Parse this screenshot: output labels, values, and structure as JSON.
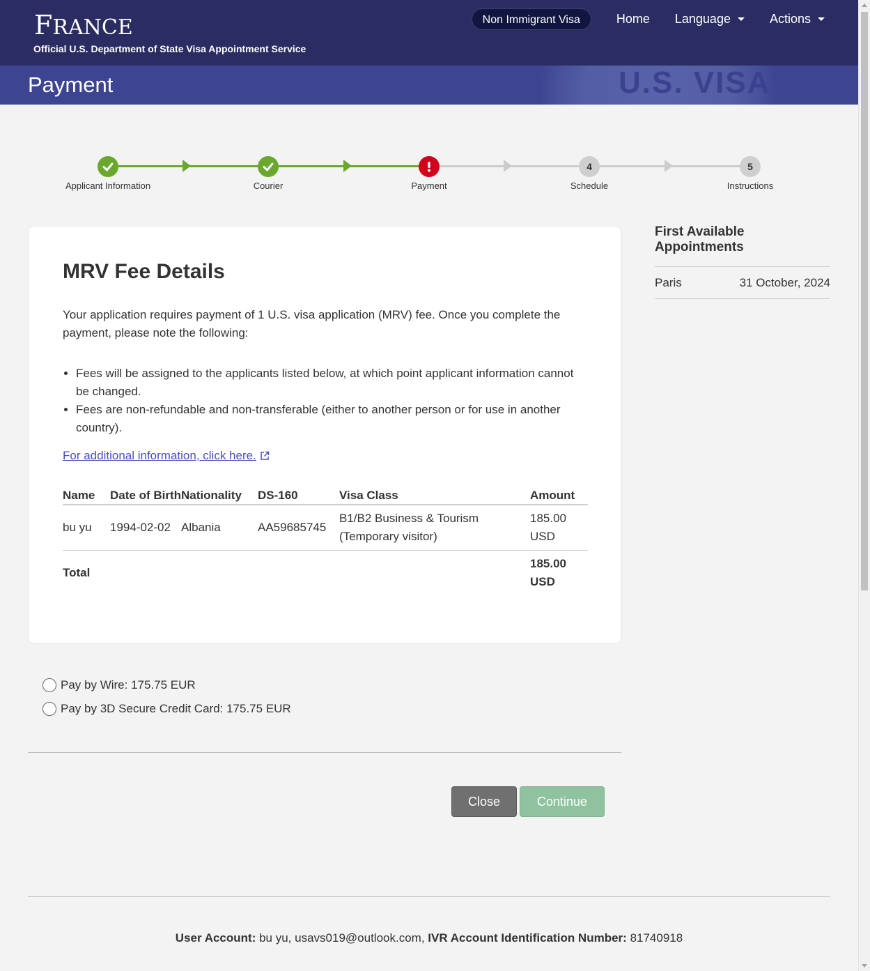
{
  "header": {
    "country_first": "F",
    "country_rest": "RANCE",
    "subtitle": "Official U.S. Department of State Visa Appointment Service",
    "nav": {
      "visa_type": "Non Immigrant Visa",
      "home": "Home",
      "language": "Language",
      "actions": "Actions"
    },
    "page_title": "Payment",
    "seal_text": "U.S. VISA"
  },
  "stepper": {
    "steps": [
      {
        "label": "Applicant Information",
        "state": "done",
        "icon": "check-icon"
      },
      {
        "label": "Courier",
        "state": "done",
        "icon": "check-icon"
      },
      {
        "label": "Payment",
        "state": "current",
        "icon": "exclamation-icon"
      },
      {
        "label": "Schedule",
        "state": "todo",
        "number": "4"
      },
      {
        "label": "Instructions",
        "state": "todo",
        "number": "5"
      }
    ]
  },
  "fee_details": {
    "title": "MRV Fee Details",
    "intro": "Your application requires payment of 1 U.S. visa application (MRV) fee. Once you complete the payment, please note the following:",
    "bullets": [
      "Fees will be assigned to the applicants listed below, at which point applicant information cannot be changed.",
      "Fees are non-refundable and non-transferable (either to another person or for use in another country)."
    ],
    "more_link": "For additional information, click here.",
    "table": {
      "headers": {
        "name": "Name",
        "dob": "Date of Birth",
        "nationality": "Nationality",
        "ds160": "DS-160",
        "visa_class": "Visa Class",
        "amount": "Amount"
      },
      "row": {
        "name": "bu yu",
        "dob": "1994-02-02",
        "nationality": "Albania",
        "ds160": "AA59685745",
        "visa_class": "B1/B2 Business & Tourism (Temporary visitor)",
        "amount": "185.00 USD"
      },
      "total_label": "Total",
      "total_amount": "185.00 USD"
    }
  },
  "sidebar": {
    "title": "First Available Appointments",
    "location": "Paris",
    "date": "31 October, 2024"
  },
  "payment_options": [
    {
      "label": "Pay by Wire: 175.75 EUR",
      "selected": false
    },
    {
      "label": "Pay by 3D Secure Credit Card: 175.75 EUR",
      "selected": false
    }
  ],
  "buttons": {
    "close": "Close",
    "continue": "Continue"
  },
  "footer": {
    "account_label": "User Account:",
    "account_value": "bu yu, usavs019@outlook.com,",
    "ivr_label": "IVR Account Identification Number:",
    "ivr_value": "81740918"
  },
  "colors": {
    "header_bg": "#2b2d62",
    "title_bg": "#3d4592",
    "step_done": "#6aa82d",
    "step_error": "#d0021b",
    "continue_btn": "#8fc29e"
  }
}
